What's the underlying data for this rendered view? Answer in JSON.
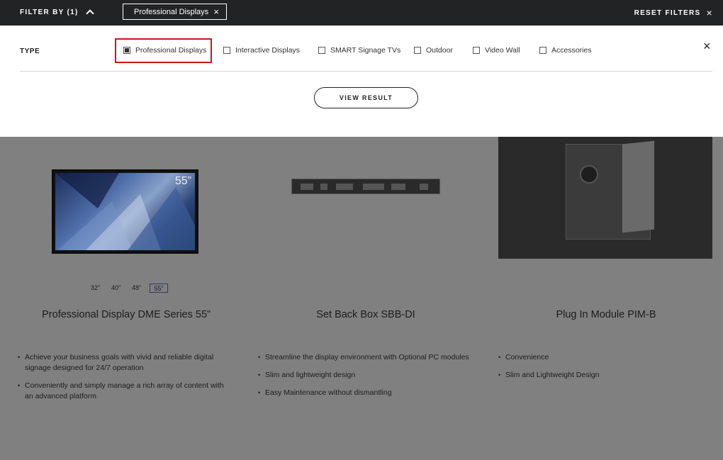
{
  "topbar": {
    "filter_by_label": "FILTER BY (1)",
    "active_chip": "Professional Displays",
    "chip_close": "×",
    "reset_label": "RESET FILTERS",
    "reset_close": "×"
  },
  "panel": {
    "type_label": "TYPE",
    "options": [
      {
        "label": "Professional Displays",
        "checked": true
      },
      {
        "label": "Interactive Displays",
        "checked": false
      },
      {
        "label": "SMART Signage TVs",
        "checked": false
      },
      {
        "label": "Outdoor",
        "checked": false
      },
      {
        "label": "Video Wall",
        "checked": false
      },
      {
        "label": "Accessories",
        "checked": false
      }
    ],
    "close": "×",
    "view_result": "VIEW RESULT"
  },
  "products": [
    {
      "title": "Professional Display DME Series 55”",
      "image_size_tag": "55”",
      "sizes": [
        "32”",
        "40”",
        "48”",
        "55”"
      ],
      "selected_size": "55”",
      "bullets": [
        "Achieve your business goals with vivid and reliable digital signage designed for 24/7 operation",
        "Conveniently and simply manage a rich array of content with an advanced platform"
      ]
    },
    {
      "title": "Set Back Box SBB-DI",
      "bullets": [
        "Streamline the display environment with Optional PC modules",
        "Slim and lightweight design",
        "Easy Maintenance without dismantling"
      ]
    },
    {
      "title": "Plug In Module PIM-B",
      "bullets": [
        "Convenience",
        "Slim and Lightweight Design"
      ]
    }
  ],
  "colors": {
    "topbar": "#222325",
    "overlay": "#808080",
    "highlight": "#d0121b"
  }
}
